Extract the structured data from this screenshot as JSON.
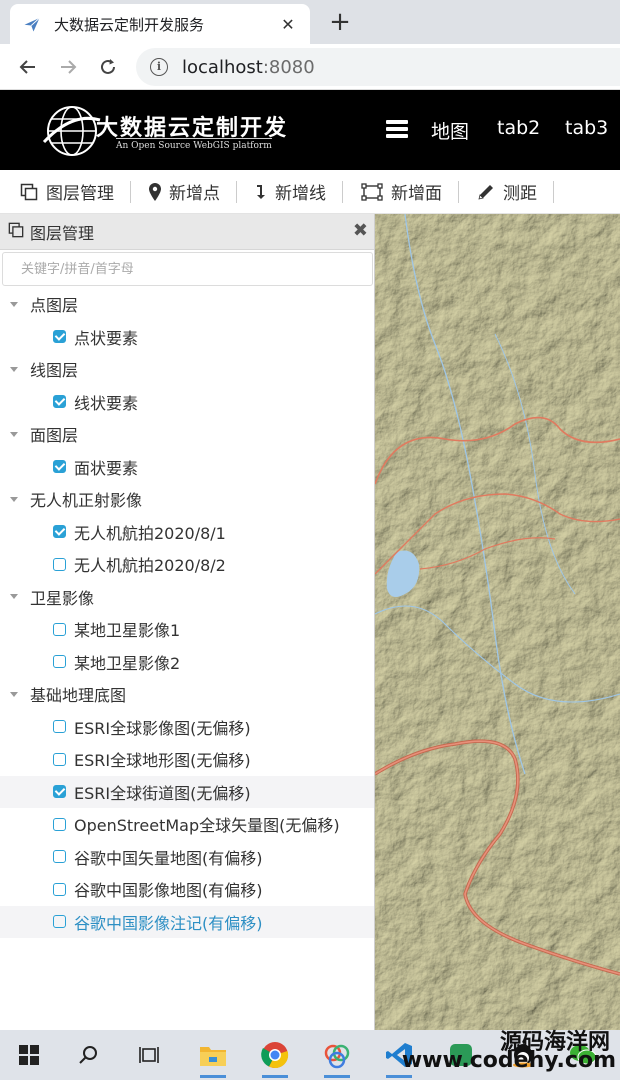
{
  "browser": {
    "tab_title": "大数据云定制开发服务",
    "close_glyph": "✕",
    "newtab_glyph": "+",
    "url_host": "localhost",
    "url_port": ":8080"
  },
  "header": {
    "logo_title": "大数据云定制开发",
    "logo_sub": "An Open Source WebGIS platform",
    "nav": [
      "地图",
      "tab2",
      "tab3"
    ]
  },
  "toolbar": {
    "layers": "图层管理",
    "add_point": "新增点",
    "add_line": "新增线",
    "add_polygon": "新增面",
    "measure": "测距"
  },
  "panel": {
    "title": "图层管理",
    "close_glyph": "✖",
    "search_placeholder": "关键字/拼音/首字母",
    "groups": [
      {
        "label": "点图层",
        "items": [
          {
            "label": "点状要素",
            "checked": true
          }
        ]
      },
      {
        "label": "线图层",
        "items": [
          {
            "label": "线状要素",
            "checked": true
          }
        ]
      },
      {
        "label": "面图层",
        "items": [
          {
            "label": "面状要素",
            "checked": true
          }
        ]
      },
      {
        "label": "无人机正射影像",
        "items": [
          {
            "label": "无人机航拍2020/8/1",
            "checked": true
          },
          {
            "label": "无人机航拍2020/8/2",
            "checked": false
          }
        ]
      },
      {
        "label": "卫星影像",
        "items": [
          {
            "label": "某地卫星影像1",
            "checked": false
          },
          {
            "label": "某地卫星影像2",
            "checked": false
          }
        ]
      },
      {
        "label": "基础地理底图",
        "items": [
          {
            "label": "ESRI全球影像图(无偏移)",
            "checked": false
          },
          {
            "label": "ESRI全球地形图(无偏移)",
            "checked": false
          },
          {
            "label": "ESRI全球街道图(无偏移)",
            "checked": true
          },
          {
            "label": "OpenStreetMap全球矢量图(无偏移)",
            "checked": false
          },
          {
            "label": "谷歌中国矢量地图(有偏移)",
            "checked": false
          },
          {
            "label": "谷歌中国影像地图(有偏移)",
            "checked": false
          },
          {
            "label": "谷歌中国影像注记(有偏移)",
            "checked": false
          }
        ]
      }
    ]
  },
  "watermark": {
    "cn": "源码海洋网",
    "url": "www.codehy.com"
  },
  "colors": {
    "checkbox": "#2aa1d6",
    "selected_text": "#2d8fc4",
    "header_bg": "#000000",
    "map_road": "#e07a5f"
  }
}
